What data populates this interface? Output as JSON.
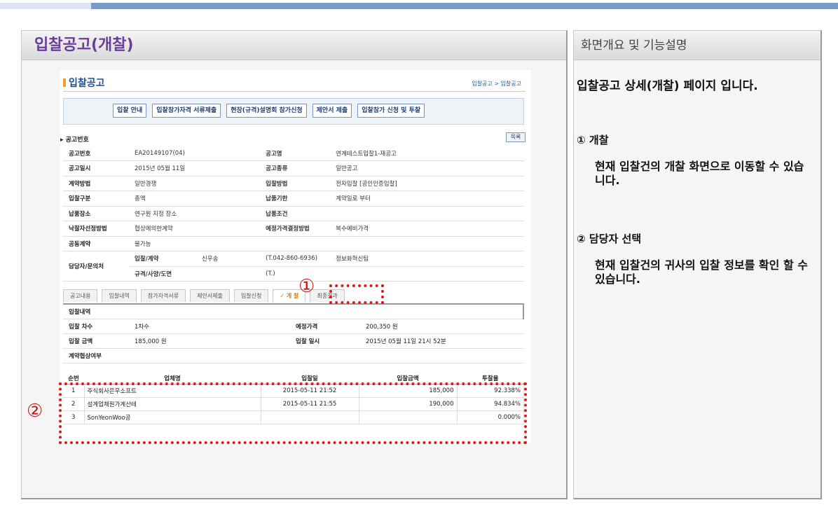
{
  "page": {
    "title": "입찰공고(개찰)",
    "right_title": "화면개요 및 기능설명"
  },
  "right": {
    "intro": "입찰공고 상세(개찰) 페이지 입니다.",
    "sections": [
      {
        "title": "① 개찰",
        "desc": "현재 입찰건의 개찰 화면으로 이동할 수 있습니다."
      },
      {
        "title": "② 담당자 선택",
        "desc": "현재 입찰건의 귀사의 입찰 정보를 확인 할 수 있습니다."
      }
    ]
  },
  "screen": {
    "title": "입찰공고",
    "breadcrumb": "입찰공고 > 입찰공고",
    "buttons": [
      "입찰 안내",
      "입찰참가자격 서류제출",
      "현장(규격)설명회 참가신청",
      "제안서 제출",
      "입찰참가 신청 및 투찰"
    ],
    "section_label": "▸ 공고번호",
    "list_button": "목록",
    "info": {
      "r1": {
        "k1": "공고번호",
        "v1": "EA20149107(04)",
        "k2": "공고명",
        "v2": "연계테스트입찰1-재공고"
      },
      "r2": {
        "k1": "공고일시",
        "v1": "2015년 05월 11일",
        "k2": "공고종류",
        "v2": "일반공고"
      },
      "r3": {
        "k1": "계약방법",
        "v1": "일반경쟁",
        "k2": "입찰방법",
        "v2": "전자입찰 [공인인증입찰]"
      },
      "r4": {
        "k1": "입찰구분",
        "v1": "총액",
        "k2": "납품기한",
        "v2": "계약일로 부터"
      },
      "r5": {
        "k1": "납품장소",
        "v1": "연구원 지정 장소",
        "k2": "납품조건",
        "v2": ""
      },
      "r6": {
        "k1": "낙찰자선정방법",
        "v1": "협상에의한계약",
        "k2": "예정가격결정방법",
        "v2": "복수예비가격"
      },
      "r7": {
        "k1": "공동계약",
        "v1": "불가능"
      },
      "contact": {
        "k": "담당자/문의처",
        "sub1": "입찰/계약",
        "name1": "신우송",
        "tel1": "(T.042-860-6936)",
        "dept1": "정보화혁신팀",
        "sub2": "규격/사양/도면",
        "tel2": "(T.)"
      }
    },
    "tabs": [
      "공고내용",
      "입찰내역",
      "참가자격서류",
      "제안서제출",
      "입찰신청",
      "✓ 개  찰",
      "최종결과"
    ],
    "bid": {
      "header": "입찰내역",
      "r1": {
        "k1": "입찰 차수",
        "v1": "1차수",
        "k2": "예정가격",
        "v2": "200,350 원"
      },
      "r2": {
        "k1": "입찰 금액",
        "v1": "185,000 원",
        "k2": "입찰 일시",
        "v2": "2015년 05월 11일 21시 52분"
      },
      "r3": {
        "k1": "계약협상여부",
        "v1": ""
      }
    },
    "results": {
      "headers": [
        "순번",
        "업체명",
        "입찰일",
        "입찰금액",
        "투찰율"
      ],
      "rows": [
        {
          "no": "1",
          "name": "주식회사은우소프트",
          "date": "2015-05-11 21:52",
          "amount": "185,000",
          "rate": "92.338%"
        },
        {
          "no": "2",
          "name": "설계업체원가계산테",
          "date": "2015-05-11 21:55",
          "amount": "190,000",
          "rate": "94.834%"
        },
        {
          "no": "3",
          "name": "SonYeonWoo공",
          "date": "",
          "amount": "",
          "rate": "0.000%"
        }
      ]
    },
    "markers": {
      "m1": "①",
      "m2": "②"
    }
  }
}
